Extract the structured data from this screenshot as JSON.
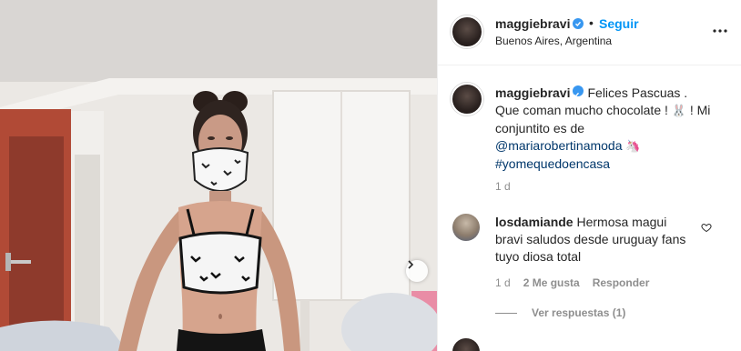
{
  "post": {
    "username": "maggiebravi",
    "dot": "•",
    "follow_label": "Seguir",
    "location": "Buenos Aires, Argentina"
  },
  "caption": {
    "username": "maggiebravi",
    "text_1": "Felices Pascuas . Que coman mucho chocolate ! ",
    "emoji_rabbit": "🐰",
    "text_2": " ! Mi conjuntito es de",
    "mention": "@mariarobertinamoda",
    "emoji_unicorn": "🦄",
    "hashtag": "#yomequedoencasa",
    "timestamp": "1 d"
  },
  "comment": {
    "username": "losdamiande",
    "text": "Hermosa magui bravi saludos desde uruguay fans tuyo diosa total",
    "time": "1 d",
    "likes": "2 Me gusta",
    "reply_label": "Responder",
    "view_replies": "Ver respuestas (1)"
  },
  "colors": {
    "accent": "#0095f6",
    "verified": "#3897f0",
    "link": "#00376b",
    "muted": "#8e8e8e"
  }
}
